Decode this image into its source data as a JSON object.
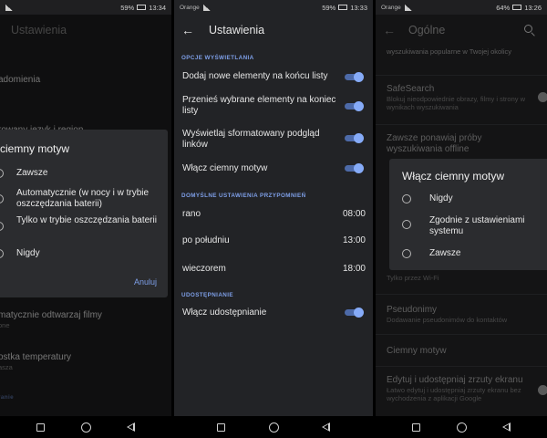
{
  "phone1": {
    "status": {
      "time": "13:34",
      "battery": "59%"
    },
    "app_bar_title": "Ustawienia",
    "bg_items": [
      {
        "title": "adomienia",
        "sub": ""
      },
      {
        "title": "rowany język i region",
        "sub": ""
      },
      {
        "title": "matycznie odtwarzaj filmy",
        "sub": "one"
      },
      {
        "title": "ostka temperatury",
        "sub": "asza"
      },
      {
        "title": "ranie",
        "sub": ""
      }
    ],
    "dialog": {
      "title": "ciemny motyw",
      "options": [
        {
          "label": "Zawsze"
        },
        {
          "label": "Automatycznie (w nocy i w trybie oszczędzania baterii)"
        },
        {
          "label": "Tylko w trybie oszczędzania baterii"
        },
        {
          "label": "Nigdy"
        }
      ],
      "cancel_label": "Anuluj"
    }
  },
  "phone2": {
    "status": {
      "carrier": "Orange",
      "time": "13:33",
      "battery": "59%"
    },
    "app_bar_title": "Ustawienia",
    "section_display": "OPCJE WYŚWIETLANIA",
    "display_items": [
      {
        "label": "Dodaj nowe elementy na końcu listy",
        "on": true
      },
      {
        "label": "Przenieś wybrane elementy na koniec listy",
        "on": true
      },
      {
        "label": "Wyświetlaj sformatowany podgląd linków",
        "on": true
      },
      {
        "label": "Włącz ciemny motyw",
        "on": true
      }
    ],
    "section_reminders": "DOMYŚLNE USTAWIENIA PRZYPOMNIEŃ",
    "reminders": [
      {
        "label": "rano",
        "time": "08:00"
      },
      {
        "label": "po południu",
        "time": "13:00"
      },
      {
        "label": "wieczorem",
        "time": "18:00"
      }
    ],
    "section_sharing": "UDOSTĘPNIANIE",
    "sharing_item": {
      "label": "Włącz udostępnianie",
      "on": true
    }
  },
  "phone3": {
    "status": {
      "carrier": "Orange",
      "time": "13:26",
      "battery": "64%"
    },
    "app_bar_title": "Ogólne",
    "bg_items": [
      {
        "title": "",
        "sub": "wyszukiwania popularne w Twojej okolicy"
      },
      {
        "title": "SafeSearch",
        "sub": "Blokuj nieodpowiednie obrazy, filmy i strony w wynikach wyszukiwania"
      },
      {
        "title": "Zawsze ponawiaj próby wyszukiwania offline",
        "sub": ""
      },
      {
        "title": "",
        "sub": "Tylko przez Wi-Fi"
      },
      {
        "title": "Pseudonimy",
        "sub": "Dodawanie pseudonimów do kontaktów"
      },
      {
        "title": "Ciemny motyw",
        "sub": ""
      },
      {
        "title": "Edytuj i udostępniaj zrzuty ekranu",
        "sub": "Łatwo edytuj i udostępniaj zrzuty ekranu bez wychodzenia z aplikacji Google"
      }
    ],
    "dialog": {
      "title": "Włącz ciemny motyw",
      "options": [
        {
          "label": "Nigdy"
        },
        {
          "label": "Zgodnie z ustawieniami systemu"
        },
        {
          "label": "Zawsze"
        }
      ]
    }
  },
  "colors": {
    "accent": "#7e9fe8",
    "toggle_on": "#86abf8",
    "background": "#1f1f21"
  }
}
